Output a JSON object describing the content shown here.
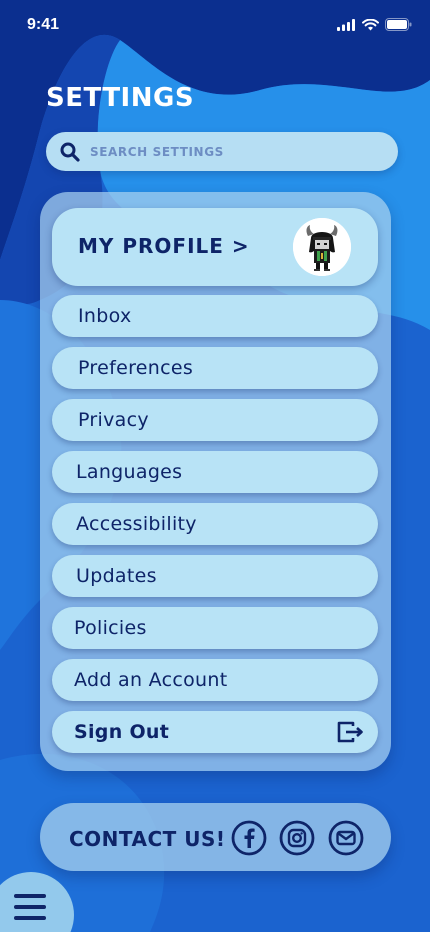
{
  "status_bar": {
    "time": "9:41",
    "icons": [
      "signal-icon",
      "wifi-icon",
      "battery-icon"
    ]
  },
  "header": {
    "title": "SETTINGS"
  },
  "search": {
    "placeholder": "SEARCH SETTINGS",
    "icon": "search-icon"
  },
  "profile": {
    "label": "MY PROFILE >",
    "avatar": "avatar-image"
  },
  "menu": {
    "items": [
      {
        "label": "Inbox"
      },
      {
        "label": "Preferences"
      },
      {
        "label": "Privacy"
      },
      {
        "label": "Languages"
      },
      {
        "label": "Accessibility"
      },
      {
        "label": "Updates"
      },
      {
        "label": "Policies"
      },
      {
        "label": "Add an Account"
      }
    ],
    "sign_out": {
      "label": "Sign Out",
      "icon": "sign-out-icon"
    }
  },
  "contact": {
    "label": "CONTACT US!",
    "icons": [
      "facebook-icon",
      "instagram-icon",
      "mail-icon"
    ]
  },
  "nav": {
    "icon": "hamburger-menu-icon"
  },
  "colors": {
    "text_dark": "#0e2468",
    "pill_bg": "#b8e3f6",
    "panel_bg": "#a8d0ee",
    "bg_dark": "#0a2f8c",
    "bg_light": "#2b8fe8"
  }
}
